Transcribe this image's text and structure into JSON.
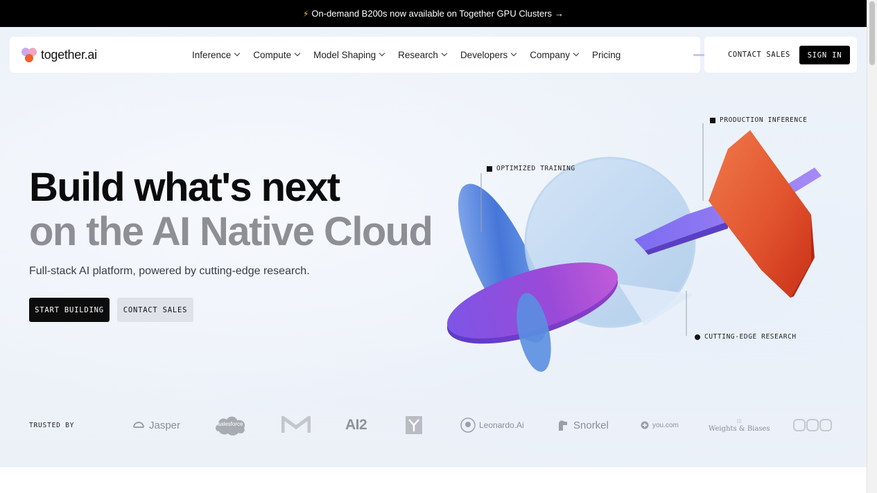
{
  "announcement": {
    "icon": "lightning-icon",
    "text": "On-demand B200s now available on Together GPU Clusters",
    "arrow": "→"
  },
  "brand": {
    "name": "together.ai"
  },
  "nav": {
    "items": [
      {
        "label": "Inference",
        "has_dropdown": true
      },
      {
        "label": "Compute",
        "has_dropdown": true
      },
      {
        "label": "Model Shaping",
        "has_dropdown": true
      },
      {
        "label": "Research",
        "has_dropdown": true
      },
      {
        "label": "Developers",
        "has_dropdown": true
      },
      {
        "label": "Company",
        "has_dropdown": true
      },
      {
        "label": "Pricing",
        "has_dropdown": false
      }
    ],
    "contact_sales": "CONTACT SALES",
    "sign_in": "SIGN IN"
  },
  "hero": {
    "headline_line1": "Build what's next",
    "headline_line2": "on the AI Native Cloud",
    "subtitle": "Full-stack AI platform, powered by cutting-edge research.",
    "cta_primary": "START BUILDING",
    "cta_secondary": "CONTACT SALES"
  },
  "illustration": {
    "callouts": {
      "production": "PRODUCTION INFERENCE",
      "training": "OPTIMIZED TRAINING",
      "research": "CUTTING-EDGE RESEARCH"
    }
  },
  "trusted": {
    "label": "TRUSTED BY",
    "logos": [
      "Jasper",
      "salesforce",
      "M",
      "AI2",
      "Y",
      "Leonardo.Ai",
      "Snorkel",
      "you.com",
      "Weights & Biases",
      "OOO"
    ]
  },
  "colors": {
    "accent_black": "#000000",
    "headline_gray": "#8d8f95",
    "hero_bg": "#edf2f9"
  }
}
